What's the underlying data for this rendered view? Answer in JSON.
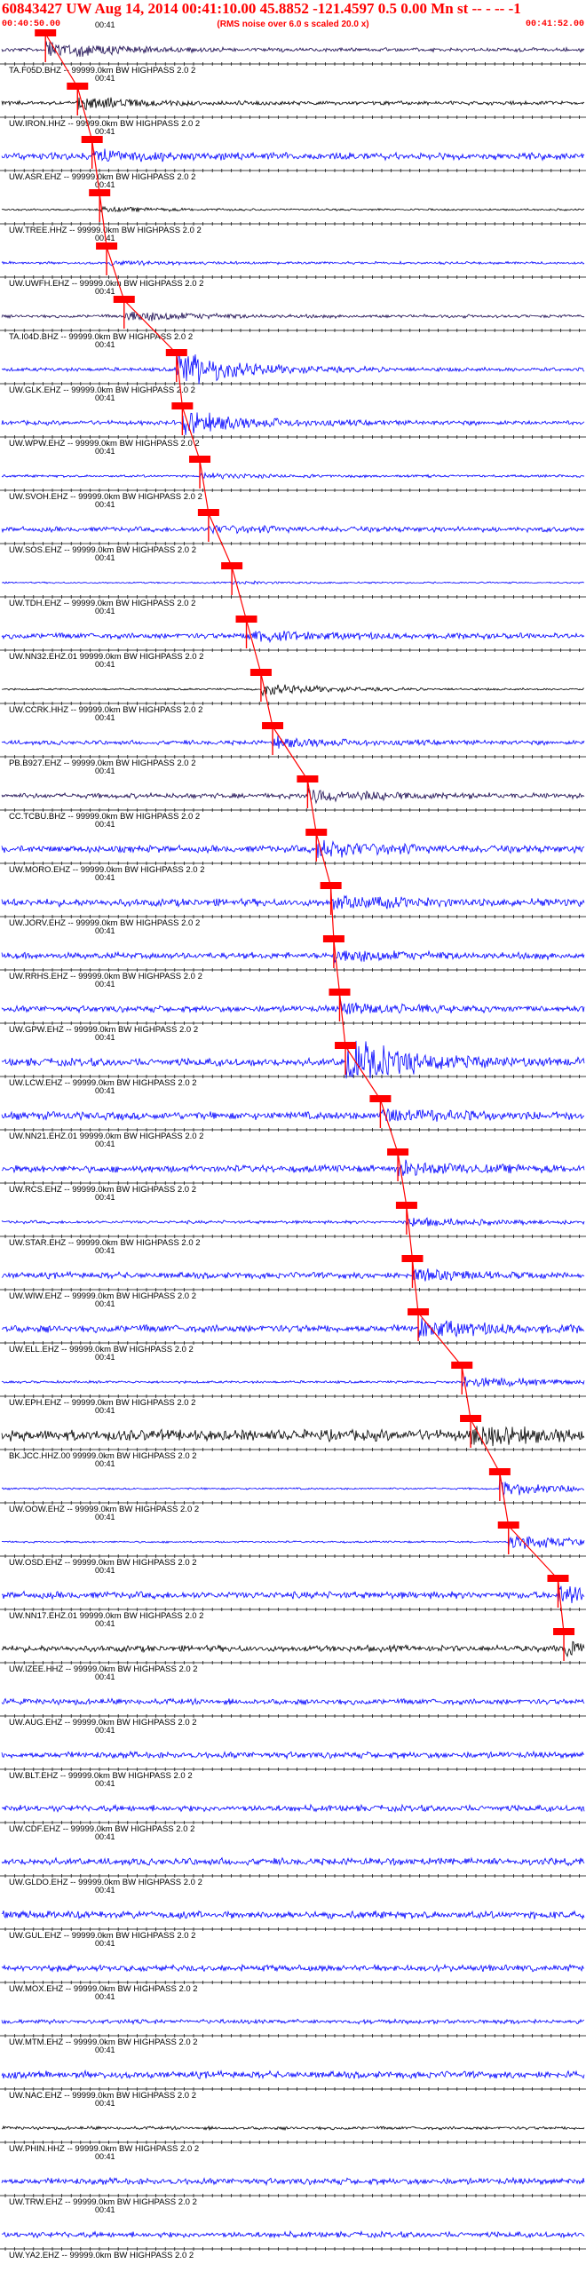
{
  "header": {
    "title": "60843427 UW Aug 14, 2014 00:41:10.00   45.8852 -121.4597  0.5 0.00 Mn st -- - --  -1",
    "subtitle": "(RMS noise over 6.0 s scaled 20.0 x)",
    "start_time": "00:40:50.00",
    "end_time": "00:41:52.00"
  },
  "chart_data": {
    "type": "line",
    "title": "60843427 UW Aug 14, 2014 00:41:10.00   45.8852 -121.4597  0.5 0.00 Mn st -- - --  -1",
    "subtitle": "(RMS noise over 6.0 s scaled 20.0 x)",
    "xlim": [
      "00:40:50.00",
      "00:41:52.00"
    ],
    "minute_tick_label": "00:41",
    "grid": false,
    "colors": {
      "text": "#ff0000",
      "blue_trace": "#0000ff",
      "black_trace": "#000000",
      "dark_trace": "#1a0a50",
      "pick": "#ff0000",
      "axis": "#000000"
    },
    "traces": [
      {
        "label": "TA.F05D.BHZ -- 99999.0km BW  HIGHPASS  2.0  2",
        "color": "dark",
        "pick_frac": 0.075,
        "amp": 0.55,
        "base": 0.12
      },
      {
        "label": "UW.IRON.HHZ -- 99999.0km BW  HIGHPASS  2.0  2",
        "color": "black",
        "pick_frac": 0.13,
        "amp": 0.35,
        "base": 0.12
      },
      {
        "label": "UW.ASR.EHZ -- 99999.0km BW  HIGHPASS  2.0  2",
        "color": "blue",
        "pick_frac": 0.155,
        "amp": 0.28,
        "base": 0.22
      },
      {
        "label": "UW.TREE.HHZ -- 99999.0km BW  HIGHPASS  2.0  2",
        "color": "black",
        "pick_frac": 0.168,
        "amp": 0.15,
        "base": 0.06
      },
      {
        "label": "UW.UWFH.EHZ -- 99999.0km BW  HIGHPASS  2.0  2",
        "color": "blue",
        "pick_frac": 0.18,
        "amp": 0.12,
        "base": 0.08
      },
      {
        "label": "TA.I04D.BHZ -- 99999.0km BW  HIGHPASS  2.0  2",
        "color": "dark",
        "pick_frac": 0.21,
        "amp": 0.35,
        "base": 0.1
      },
      {
        "label": "UW.GLK.EHZ -- 99999.0km BW  HIGHPASS  2.0  2",
        "color": "blue",
        "pick_frac": 0.3,
        "amp": 1.1,
        "base": 0.12
      },
      {
        "label": "UW.WPW.EHZ -- 99999.0km BW  HIGHPASS  2.0  2",
        "color": "blue",
        "pick_frac": 0.31,
        "amp": 0.7,
        "base": 0.14
      },
      {
        "label": "UW.SVOH.EHZ -- 99999.0km BW  HIGHPASS  2.0  2",
        "color": "blue",
        "pick_frac": 0.34,
        "amp": 0.15,
        "base": 0.08
      },
      {
        "label": "UW.SOS.EHZ -- 99999.0km BW  HIGHPASS  2.0  2",
        "color": "blue",
        "pick_frac": 0.355,
        "amp": 0.2,
        "base": 0.16
      },
      {
        "label": "UW.TDH.EHZ -- 99999.0km BW  HIGHPASS  2.0  2",
        "color": "blue",
        "pick_frac": 0.395,
        "amp": 0.08,
        "base": 0.05
      },
      {
        "label": "UW.NN32.EHZ.01 99999.0km BW  HIGHPASS  2.0  2",
        "color": "blue",
        "pick_frac": 0.42,
        "amp": 0.3,
        "base": 0.18
      },
      {
        "label": "UW.CCRK.HHZ -- 99999.0km BW  HIGHPASS  2.0  2",
        "color": "black",
        "pick_frac": 0.445,
        "amp": 0.4,
        "base": 0.06
      },
      {
        "label": "PB.B927.EHZ -- 99999.0km BW  HIGHPASS  2.0  2",
        "color": "blue",
        "pick_frac": 0.465,
        "amp": 0.3,
        "base": 0.14
      },
      {
        "label": "CC.TCBU.BHZ -- 99999.0km BW  HIGHPASS  2.0  2",
        "color": "dark",
        "pick_frac": 0.525,
        "amp": 0.4,
        "base": 0.16
      },
      {
        "label": "UW.MORO.EHZ -- 99999.0km BW  HIGHPASS  2.0  2",
        "color": "blue",
        "pick_frac": 0.54,
        "amp": 0.5,
        "base": 0.22
      },
      {
        "label": "UW.JORV.EHZ -- 99999.0km BW  HIGHPASS  2.0  2",
        "color": "blue",
        "pick_frac": 0.565,
        "amp": 0.4,
        "base": 0.24
      },
      {
        "label": "UW.RRHS.EHZ -- 99999.0km BW  HIGHPASS  2.0  2",
        "color": "blue",
        "pick_frac": 0.57,
        "amp": 0.35,
        "base": 0.2
      },
      {
        "label": "UW.GPW.EHZ -- 99999.0km BW  HIGHPASS  2.0  2",
        "color": "blue",
        "pick_frac": 0.58,
        "amp": 0.3,
        "base": 0.2
      },
      {
        "label": "UW.LCW.EHZ -- 99999.0km BW  HIGHPASS  2.0  2",
        "color": "blue",
        "pick_frac": 0.59,
        "amp": 1.3,
        "base": 0.25
      },
      {
        "label": "UW.NN21.EHZ.01 99999.0km BW  HIGHPASS  2.0  2",
        "color": "blue",
        "pick_frac": 0.65,
        "amp": 0.4,
        "base": 0.25
      },
      {
        "label": "UW.RCS.EHZ -- 99999.0km BW  HIGHPASS  2.0  2",
        "color": "blue",
        "pick_frac": 0.68,
        "amp": 0.4,
        "base": 0.22
      },
      {
        "label": "UW.STAR.EHZ -- 99999.0km BW  HIGHPASS  2.0  2",
        "color": "blue",
        "pick_frac": 0.695,
        "amp": 0.3,
        "base": 0.1
      },
      {
        "label": "UW.WIW.EHZ -- 99999.0km BW  HIGHPASS  2.0  2",
        "color": "blue",
        "pick_frac": 0.705,
        "amp": 0.25,
        "base": 0.2
      },
      {
        "label": "UW.ELL.EHZ -- 99999.0km BW  HIGHPASS  2.0  2",
        "color": "blue",
        "pick_frac": 0.715,
        "amp": 0.5,
        "base": 0.24
      },
      {
        "label": "UW.EPH.EHZ -- 99999.0km BW  HIGHPASS  2.0  2",
        "color": "blue",
        "pick_frac": 0.79,
        "amp": 0.4,
        "base": 0.08
      },
      {
        "label": "BK.JCC.HHZ.00 99999.0km BW  HIGHPASS  2.0  2",
        "color": "black",
        "pick_frac": 0.805,
        "amp": 0.5,
        "base": 0.35
      },
      {
        "label": "UW.OOW.EHZ -- 99999.0km BW  HIGHPASS  2.0  2",
        "color": "blue",
        "pick_frac": 0.855,
        "amp": 0.5,
        "base": 0.06
      },
      {
        "label": "UW.OSD.EHZ -- 99999.0km BW  HIGHPASS  2.0  2",
        "color": "blue",
        "pick_frac": 0.87,
        "amp": 0.5,
        "base": 0.06
      },
      {
        "label": "UW.NN17.EHZ.01 99999.0km BW  HIGHPASS  2.0  2",
        "color": "blue",
        "pick_frac": 0.955,
        "amp": 0.6,
        "base": 0.22
      },
      {
        "label": "UW.IZEE.HHZ -- 99999.0km BW  HIGHPASS  2.0  2",
        "color": "black",
        "pick_frac": 0.965,
        "amp": 0.4,
        "base": 0.2
      },
      {
        "label": "UW.AUG.EHZ -- 99999.0km BW  HIGHPASS  2.0  2",
        "color": "blue",
        "pick_frac": null,
        "amp": 0,
        "base": 0.18
      },
      {
        "label": "UW.BLT.EHZ -- 99999.0km BW  HIGHPASS  2.0  2",
        "color": "blue",
        "pick_frac": null,
        "amp": 0,
        "base": 0.2
      },
      {
        "label": "UW.CDF.EHZ -- 99999.0km BW  HIGHPASS  2.0  2",
        "color": "blue",
        "pick_frac": null,
        "amp": 0,
        "base": 0.2
      },
      {
        "label": "UW.GLDO.EHZ -- 99999.0km BW  HIGHPASS  2.0  2",
        "color": "blue",
        "pick_frac": null,
        "amp": 0.1,
        "base": 0.22
      },
      {
        "label": "UW.GUL.EHZ -- 99999.0km BW  HIGHPASS  2.0  2",
        "color": "blue",
        "pick_frac": null,
        "amp": 0,
        "base": 0.24
      },
      {
        "label": "UW.MOX.EHZ -- 99999.0km BW  HIGHPASS  2.0  2",
        "color": "blue",
        "pick_frac": null,
        "amp": 0,
        "base": 0.2
      },
      {
        "label": "UW.MTM.EHZ -- 99999.0km BW  HIGHPASS  2.0  2",
        "color": "blue",
        "pick_frac": null,
        "amp": 0,
        "base": 0.14
      },
      {
        "label": "UW.NAC.EHZ -- 99999.0km BW  HIGHPASS  2.0  2",
        "color": "blue",
        "pick_frac": null,
        "amp": 0,
        "base": 0.22
      },
      {
        "label": "UW.PHIN.HHZ -- 99999.0km BW  HIGHPASS  2.0  2",
        "color": "black",
        "pick_frac": null,
        "amp": 0,
        "base": 0.1
      },
      {
        "label": "UW.TRW.EHZ -- 99999.0km BW  HIGHPASS  2.0  2",
        "color": "blue",
        "pick_frac": null,
        "amp": 0,
        "base": 0.2
      },
      {
        "label": "UW.YA2.EHZ -- 99999.0km BW  HIGHPASS  2.0  2",
        "color": "blue",
        "pick_frac": null,
        "amp": 0,
        "base": 0.18
      }
    ]
  }
}
